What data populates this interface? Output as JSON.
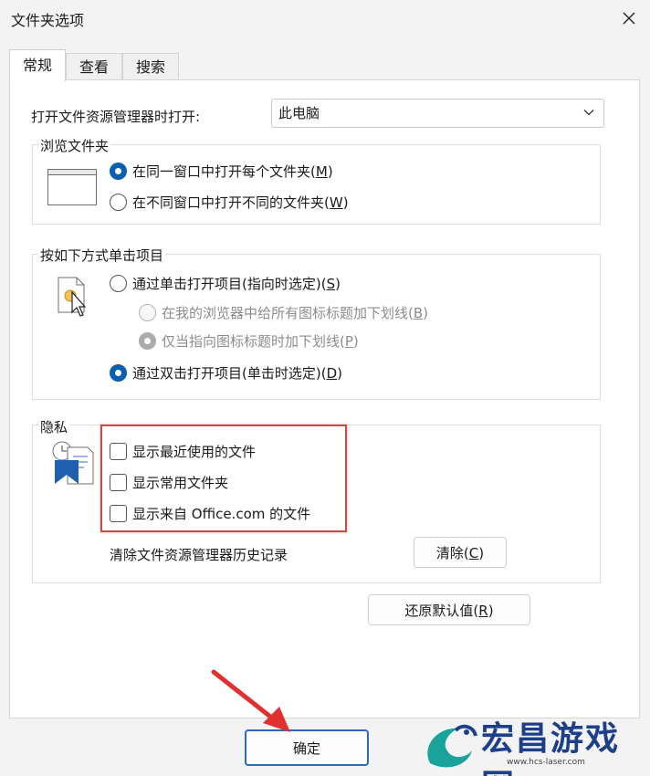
{
  "window": {
    "title": "文件夹选项"
  },
  "tabs": [
    {
      "label": "常规",
      "active": true
    },
    {
      "label": "查看",
      "active": false
    },
    {
      "label": "搜索",
      "active": false
    }
  ],
  "open_explorer": {
    "label": "打开文件资源管理器时打开:",
    "value": "此电脑"
  },
  "browse_folders": {
    "title": "浏览文件夹",
    "options": [
      {
        "text": "在同一窗口中打开每个文件夹(",
        "key": "M",
        "tail": ")",
        "checked": true
      },
      {
        "text": "在不同窗口中打开不同的文件夹(",
        "key": "W",
        "tail": ")",
        "checked": false
      }
    ]
  },
  "click_items": {
    "title": "按如下方式单击项目",
    "single_click": {
      "text": "通过单击打开项目(指向时选定)(",
      "key": "S",
      "tail": ")",
      "checked": false
    },
    "underline_all": {
      "text": "在我的浏览器中给所有图标标题加下划线(",
      "key": "B",
      "tail": ")",
      "checked": false
    },
    "underline_point": {
      "text": "仅当指向图标标题时加下划线(",
      "key": "P",
      "tail": ")",
      "checked": true
    },
    "double_click": {
      "text": "通过双击打开项目(单击时选定)(",
      "key": "D",
      "tail": ")",
      "checked": true
    }
  },
  "privacy": {
    "title": "隐私",
    "checkboxes": [
      {
        "label": "显示最近使用的文件",
        "checked": false
      },
      {
        "label": "显示常用文件夹",
        "checked": false
      },
      {
        "label": "显示来自 Office.com 的文件",
        "checked": false
      }
    ],
    "clear_history_label": "清除文件资源管理器历史记录",
    "clear_button": {
      "text": "清除(",
      "key": "C",
      "tail": ")"
    }
  },
  "restore_button": {
    "text": "还原默认值(",
    "key": "R",
    "tail": ")"
  },
  "ok_button": {
    "label": "确定"
  },
  "watermark": {
    "brand": "宏昌游戏网",
    "url": "www.hcs-laser.com"
  },
  "colors": {
    "accent": "#0a5fb4",
    "highlight": "#c74b4b",
    "arrow": "#e23030"
  }
}
